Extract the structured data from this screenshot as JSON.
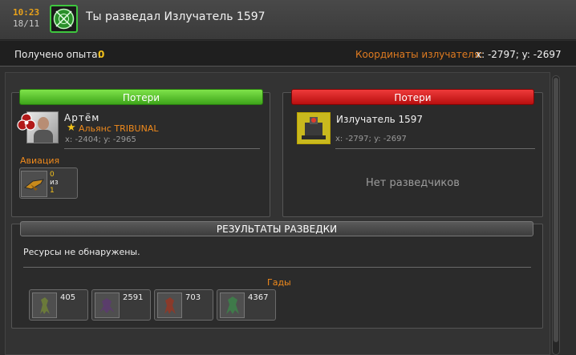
{
  "header": {
    "time": "10:23",
    "date": "18/11",
    "title": "Ты разведал Излучатель 1597"
  },
  "info": {
    "exp_label": "Получено опыта:",
    "exp_value": "0",
    "coords_label": "Координаты излучателя:",
    "coords_value": "x: -2797; y: -2697"
  },
  "left_panel": {
    "header": "Потери",
    "player_name": "Артём",
    "alliance": "Альянс TRIBUNAL",
    "coords": "x: -2404; y: -2965",
    "aviation_label": "Авиация",
    "unit": {
      "n1": "0",
      "n2": "из",
      "n3": "1"
    }
  },
  "right_panel": {
    "header": "Потери",
    "target_name": "Излучатель 1597",
    "coords": "x: -2797; y: -2697",
    "no_scouts": "Нет разведчиков"
  },
  "results": {
    "header": "РЕЗУЛЬТАТЫ РАЗВЕДКИ",
    "resources_text": "Ресурсы не обнаружены.",
    "vermin_label": "Гады",
    "monsters": [
      "405",
      "2591",
      "703",
      "4367"
    ]
  },
  "colors": {
    "accent_orange": "#f08a1c",
    "accent_yellow": "#f4c21b",
    "header_green": "#3ea51a",
    "header_red": "#b80f0f"
  },
  "icons": {
    "topbar": "radar-icon",
    "alliance": "alliance-emblem-icon",
    "aviation_unit": "aircraft-icon",
    "emitter": "emitter-building-icon",
    "monster": "monster-icon"
  }
}
